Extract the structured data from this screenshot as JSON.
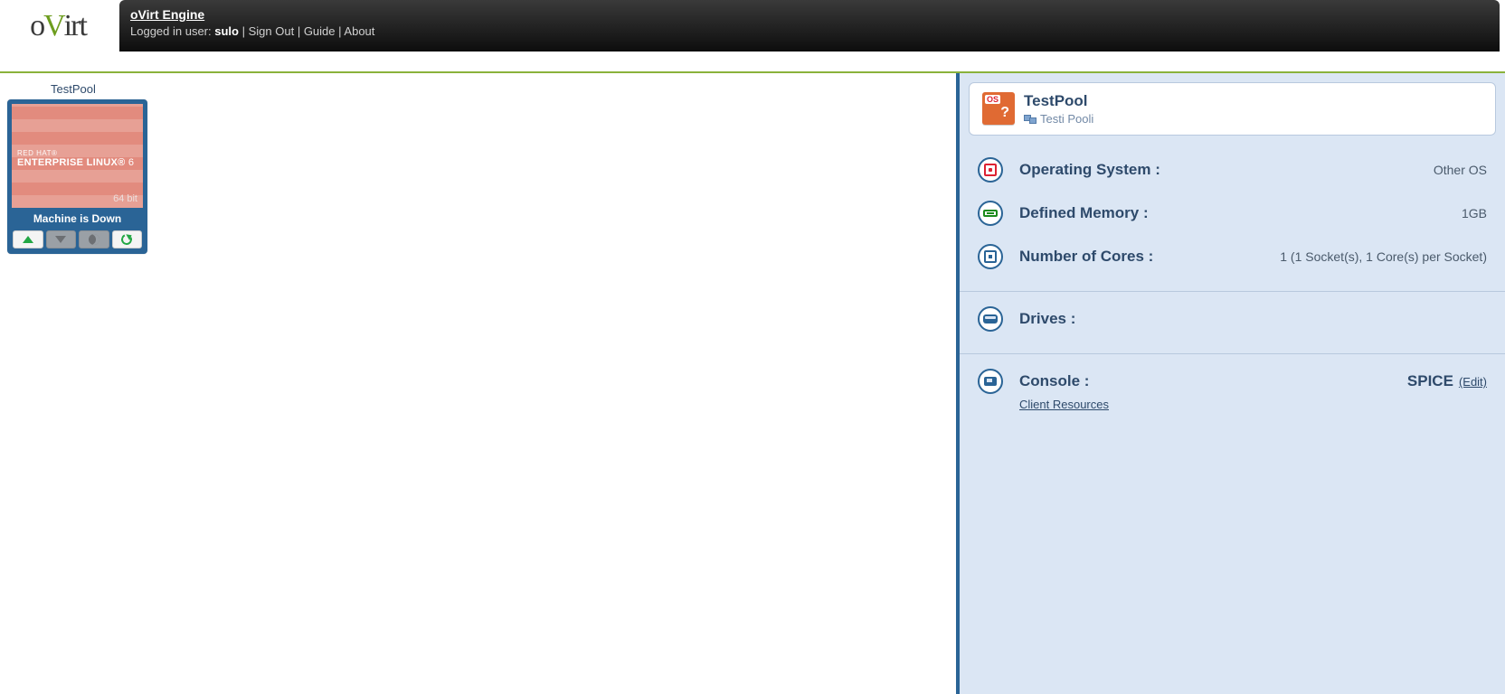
{
  "header": {
    "product": "oVirt",
    "title": "oVirt Engine",
    "logged_in_prefix": "Logged in user: ",
    "user": "sulo",
    "sign_out": "Sign Out",
    "guide": "Guide",
    "about": "About"
  },
  "vm": {
    "label": "TestPool",
    "thumb_brand": "RED HAT®",
    "thumb_line": "ENTERPRISE LINUX®",
    "thumb_version": "6",
    "thumb_arch": "64 bit",
    "status": "Machine is Down"
  },
  "details": {
    "name": "TestPool",
    "description": "Testi Pooli",
    "os_label": "Operating System :",
    "os_value": "Other OS",
    "mem_label": "Defined Memory :",
    "mem_value": "1GB",
    "cores_label": "Number of Cores :",
    "cores_value": "1 (1 Socket(s), 1 Core(s) per Socket)",
    "drives_label": "Drives :",
    "console_label": "Console :",
    "console_value": "SPICE",
    "console_edit": "(Edit)",
    "client_resources": "Client Resources"
  }
}
